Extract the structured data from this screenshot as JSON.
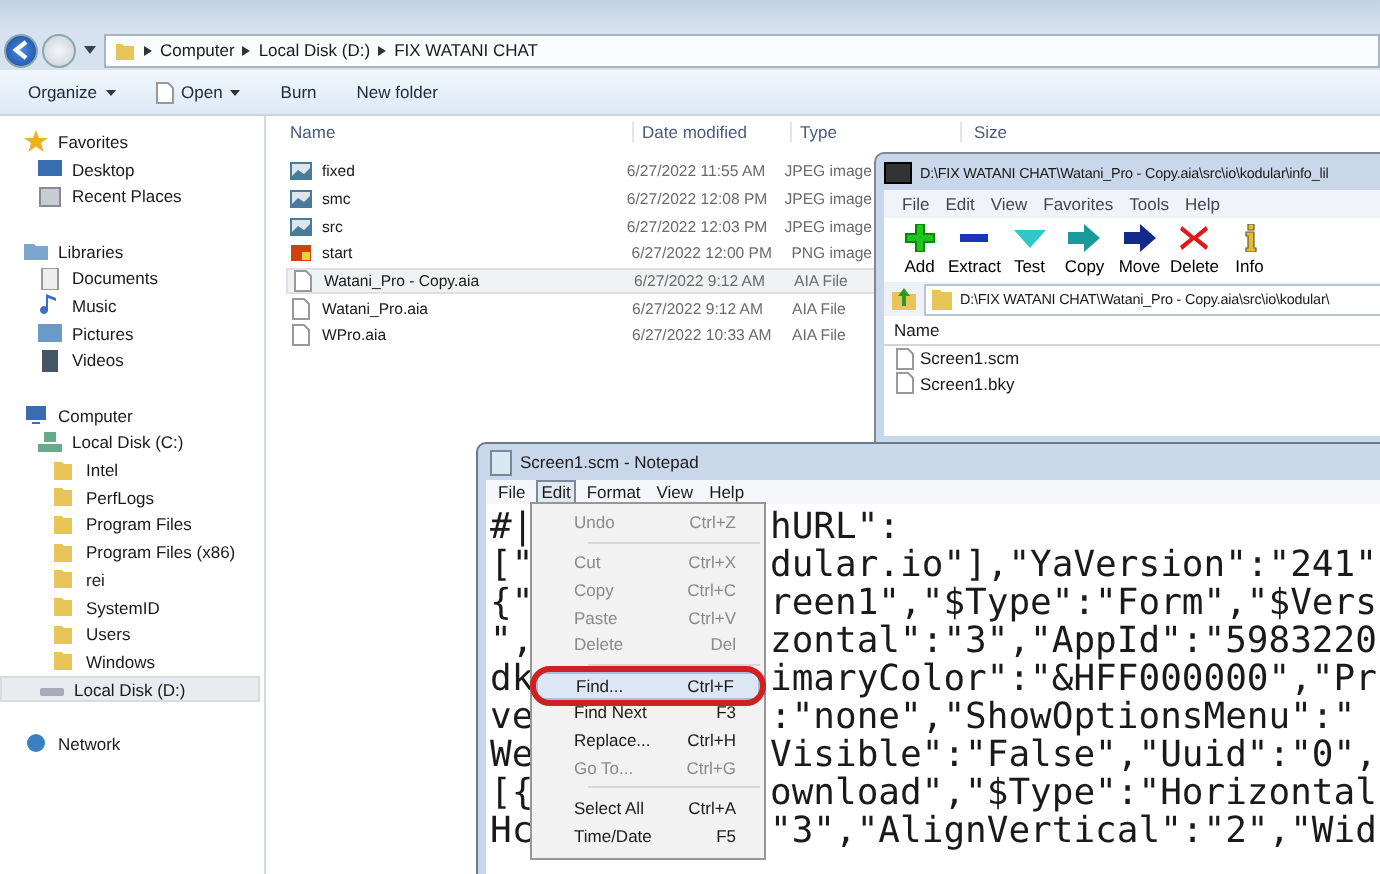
{
  "explorer": {
    "breadcrumb": [
      "Computer",
      "Local Disk (D:)",
      "FIX WATANI CHAT"
    ],
    "toolbar": [
      {
        "label": "Organize",
        "kind": "menu"
      },
      {
        "label": "Open",
        "kind": "filemenu"
      },
      {
        "label": "Burn",
        "kind": "plain"
      },
      {
        "label": "New folder",
        "kind": "plain"
      }
    ],
    "nav": [
      {
        "label": "Favorites",
        "kind": "star",
        "selected": false,
        "children": [
          {
            "label": "Desktop",
            "kind": "desktop",
            "selected": false
          },
          {
            "label": "Recent Places",
            "kind": "recent",
            "selected": false
          }
        ]
      },
      {
        "label": "Libraries",
        "kind": "library",
        "selected": false,
        "children": [
          {
            "label": "Documents",
            "kind": "documents",
            "selected": false
          },
          {
            "label": "Music",
            "kind": "music",
            "selected": false
          },
          {
            "label": "Pictures",
            "kind": "pictures",
            "selected": false
          },
          {
            "label": "Videos",
            "kind": "videos",
            "selected": false
          }
        ]
      },
      {
        "label": "Computer",
        "kind": "computer",
        "selected": false,
        "children": [
          {
            "label": "Local Disk (C:)",
            "kind": "windrive",
            "selected": false,
            "children": [
              {
                "label": "Intel",
                "kind": "folder",
                "selected": false
              },
              {
                "label": "PerfLogs",
                "kind": "folder",
                "selected": false
              },
              {
                "label": "Program Files",
                "kind": "folder",
                "selected": false
              },
              {
                "label": "Program Files (x86)",
                "kind": "folder",
                "selected": false
              },
              {
                "label": "rei",
                "kind": "folder",
                "selected": false
              },
              {
                "label": "SystemID",
                "kind": "folder",
                "selected": false
              },
              {
                "label": "Users",
                "kind": "folder",
                "selected": false
              },
              {
                "label": "Windows",
                "kind": "folder",
                "selected": false
              }
            ]
          },
          {
            "label": "Local Disk (D:)",
            "kind": "drive",
            "selected": true
          }
        ]
      },
      {
        "label": "Network",
        "kind": "network",
        "selected": false
      }
    ],
    "columns": [
      "Name",
      "Date modified",
      "Type",
      "Size"
    ],
    "files": [
      {
        "name": "fixed",
        "date": "6/27/2022 11:55 AM",
        "type": "JPEG image",
        "kind": "image",
        "selected": false
      },
      {
        "name": "smc",
        "date": "6/27/2022 12:08 PM",
        "type": "JPEG image",
        "kind": "image",
        "selected": false
      },
      {
        "name": "src",
        "date": "6/27/2022 12:03 PM",
        "type": "JPEG image",
        "kind": "image",
        "selected": false
      },
      {
        "name": "start",
        "date": "6/27/2022 12:00 PM",
        "type": "PNG image",
        "kind": "png",
        "selected": false
      },
      {
        "name": "Watani_Pro - Copy.aia",
        "date": "6/27/2022 9:12 AM",
        "type": "AIA File",
        "kind": "file",
        "selected": true
      },
      {
        "name": "Watani_Pro.aia",
        "date": "6/27/2022 9:12 AM",
        "type": "AIA File",
        "kind": "file",
        "selected": false
      },
      {
        "name": "WPro.aia",
        "date": "6/27/2022 10:33 AM",
        "type": "AIA File",
        "kind": "file",
        "selected": false
      }
    ]
  },
  "archiver": {
    "title": "D:\\FIX WATANI CHAT\\Watani_Pro - Copy.aia\\src\\io\\kodular\\info_lil",
    "menu": [
      "File",
      "Edit",
      "View",
      "Favorites",
      "Tools",
      "Help"
    ],
    "tools": [
      {
        "label": "Add",
        "kind": "add"
      },
      {
        "label": "Extract",
        "kind": "extract"
      },
      {
        "label": "Test",
        "kind": "test"
      },
      {
        "label": "Copy",
        "kind": "copy"
      },
      {
        "label": "Move",
        "kind": "move"
      },
      {
        "label": "Delete",
        "kind": "delete"
      },
      {
        "label": "Info",
        "kind": "info"
      }
    ],
    "path": "D:\\FIX WATANI CHAT\\Watani_Pro - Copy.aia\\src\\io\\kodular\\",
    "columns": [
      "Name"
    ],
    "files": [
      "Screen1.scm",
      "Screen1.bky"
    ]
  },
  "notepad": {
    "title": "Screen1.scm - Notepad",
    "menu": [
      {
        "label": "File",
        "selected": false
      },
      {
        "label": "Edit",
        "selected": true
      },
      {
        "label": "Format",
        "selected": false
      },
      {
        "label": "View",
        "selected": false
      },
      {
        "label": "Help",
        "selected": false
      }
    ],
    "lines": [
      {
        "left": "#|",
        "right": "hURL\":"
      },
      {
        "left": "[\"",
        "right": "dular.io\"],\"YaVersion\":\"241\""
      },
      {
        "left": "{\"",
        "right": "reen1\",\"$Type\":\"Form\",\"$Vers"
      },
      {
        "left": "\",",
        "right": "zontal\":\"3\",\"AppId\":\"5983220"
      },
      {
        "left": "dk",
        "right": "imaryColor\":\"&HFF000000\",\"Pr"
      },
      {
        "left": "ve",
        "right": ":\"none\",\"ShowOptionsMenu\":\""
      },
      {
        "left": "We",
        "right": "Visible\":\"False\",\"Uuid\":\"0\","
      },
      {
        "left": "[{",
        "right": "ownload\",\"$Type\":\"Horizontal"
      },
      {
        "left": "Hc",
        "right": "\"3\",\"AlignVertical\":\"2\",\"Wid"
      }
    ],
    "edit_menu": [
      {
        "kind": "item",
        "label": "Undo",
        "shortcut": "Ctrl+Z",
        "disabled": true,
        "selected": false
      },
      {
        "kind": "separator"
      },
      {
        "kind": "item",
        "label": "Cut",
        "shortcut": "Ctrl+X",
        "disabled": true,
        "selected": false
      },
      {
        "kind": "item",
        "label": "Copy",
        "shortcut": "Ctrl+C",
        "disabled": true,
        "selected": false
      },
      {
        "kind": "item",
        "label": "Paste",
        "shortcut": "Ctrl+V",
        "disabled": true,
        "selected": false
      },
      {
        "kind": "item",
        "label": "Delete",
        "shortcut": "Del",
        "disabled": true,
        "selected": false
      },
      {
        "kind": "separator"
      },
      {
        "kind": "item",
        "label": "Find...",
        "shortcut": "Ctrl+F",
        "disabled": false,
        "selected": true
      },
      {
        "kind": "item",
        "label": "Find Next",
        "shortcut": "F3",
        "disabled": false,
        "selected": false
      },
      {
        "kind": "item",
        "label": "Replace...",
        "shortcut": "Ctrl+H",
        "disabled": false,
        "selected": false
      },
      {
        "kind": "item",
        "label": "Go To...",
        "shortcut": "Ctrl+G",
        "disabled": true,
        "selected": false
      },
      {
        "kind": "separator"
      },
      {
        "kind": "item",
        "label": "Select All",
        "shortcut": "Ctrl+A",
        "disabled": false,
        "selected": false
      },
      {
        "kind": "item",
        "label": "Time/Date",
        "shortcut": "F5",
        "disabled": false,
        "selected": false
      }
    ]
  }
}
